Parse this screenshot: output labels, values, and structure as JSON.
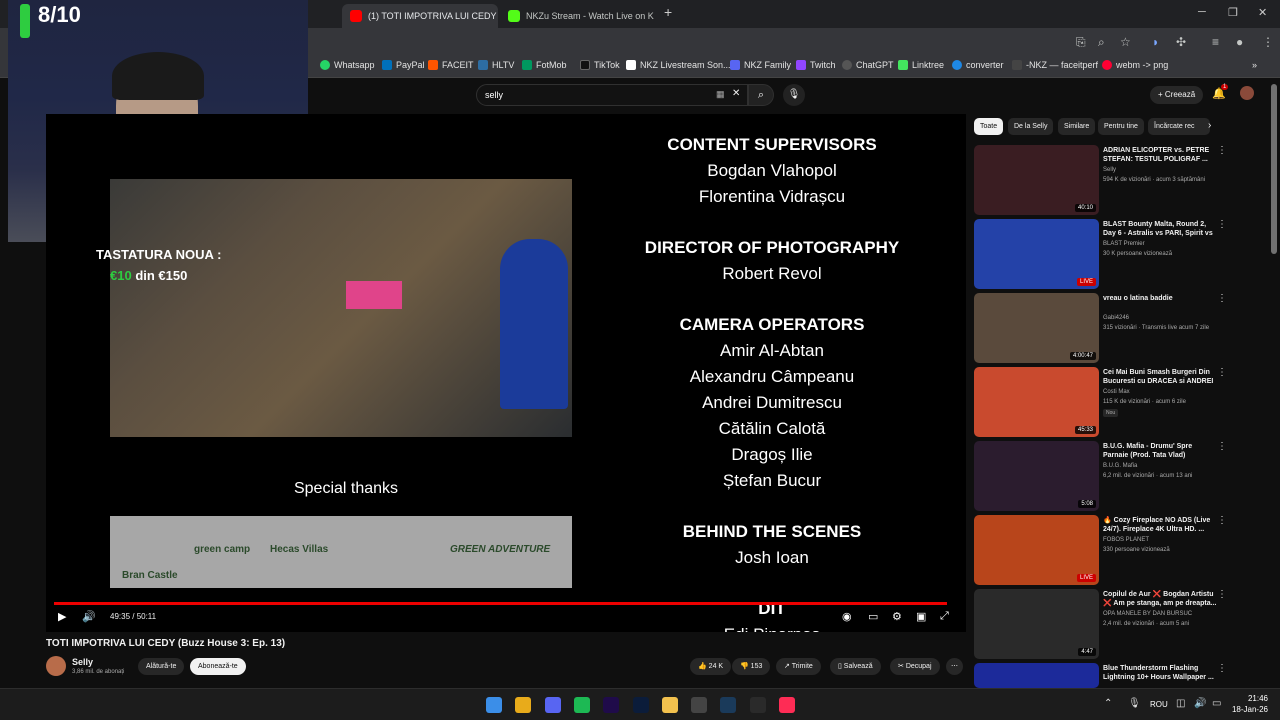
{
  "browser": {
    "tabs": [
      {
        "label": "(1) TOTI IMPOTRIVA LUI CEDY (",
        "active": true,
        "favicon_color": "#ff0000"
      },
      {
        "label": "NKZu Stream - Watch Live on K",
        "active": false,
        "favicon_color": "#53fc18"
      }
    ],
    "bookmarks": [
      {
        "label": "Whatsapp",
        "color": "#25d366"
      },
      {
        "label": "PayPal",
        "color": "#0070ba"
      },
      {
        "label": "FACEIT",
        "color": "#ff5500"
      },
      {
        "label": "HLTV",
        "color": "#2d6da3"
      },
      {
        "label": "FotMob",
        "color": "#00985f"
      },
      {
        "label": "TikTok",
        "color": "#111111"
      },
      {
        "label": "NKZ Livestream Son...",
        "color": "#ffffff"
      },
      {
        "label": "NKZ Family",
        "color": "#5865f2"
      },
      {
        "label": "Twitch",
        "color": "#9146ff"
      },
      {
        "label": "ChatGPT",
        "color": "#555555"
      },
      {
        "label": "Linktree",
        "color": "#43e55e"
      },
      {
        "label": "converter",
        "color": "#1e88e5"
      },
      {
        "label": "-NKZ — faceitperf",
        "color": "#444444"
      },
      {
        "label": "webm -> png",
        "color": "#ff0033"
      }
    ]
  },
  "overlay": {
    "score": "8/10"
  },
  "youtube": {
    "search_query": "selly",
    "create_label": "Creează",
    "notifications_count": "1"
  },
  "video": {
    "overlay_line1": "TASTATURA NOUA :",
    "overlay_price_green": "€10",
    "overlay_price_rest": " din €150",
    "special_thanks": "Special thanks",
    "sponsors": [
      "Bran Castle",
      "green camp",
      "Hecas Villas",
      "GREEN ADVENTURE"
    ],
    "credits": [
      {
        "heading": "CONTENT SUPERVISORS",
        "names": [
          "Bogdan Vlahopol",
          "Florentina Vidrașcu"
        ]
      },
      {
        "heading": "DIRECTOR OF PHOTOGRAPHY",
        "names": [
          "Robert Revol"
        ]
      },
      {
        "heading": "CAMERA OPERATORS",
        "names": [
          "Amir Al-Abtan",
          "Alexandru Câmpeanu",
          "Andrei Dumitrescu",
          "Cătălin Calotă",
          "Dragoș Ilie",
          "Ștefan Bucur"
        ]
      },
      {
        "heading": "BEHIND THE SCENES",
        "names": [
          "Josh Ioan"
        ]
      },
      {
        "heading": "DIT",
        "names": [
          "Edi Pinarpas"
        ]
      }
    ],
    "time": "49:35 / 50:11",
    "progress": 0.988,
    "title": "TOTI IMPOTRIVA LUI CEDY (Buzz House 3: Ep. 13)",
    "channel": "Selly",
    "subscribers": "3,86 mil. de abonați",
    "join_label": "Alătură-te",
    "subscribed_label": "Abonează-te",
    "likes": "24 K",
    "dislikes": "153",
    "share_label": "Trimite",
    "save_label": "Salvează",
    "clip_label": "Decupaj"
  },
  "sidebar": {
    "chips": [
      "Toate",
      "De la Selly",
      "Similare",
      "Pentru tine",
      "Încărcate rec"
    ],
    "items": [
      {
        "title": "ADRIAN ELICOPTER vs. PETRE STEFAN: TESTUL POLIGRAF ...",
        "channel": "Selly",
        "meta": "594 K de vizionări · acum 3 săptămâni",
        "duration": "40:10",
        "live": false,
        "color": "#3a1d22",
        "badge": ""
      },
      {
        "title": "BLAST Bounty Malta, Round 2, Day 6 - Astralis vs PARI, Spirit vs IC, ...",
        "channel": "BLAST Premier",
        "meta": "30 K persoane vizionează",
        "duration": "LIVE",
        "live": true,
        "color": "#2442a8",
        "badge": ""
      },
      {
        "title": "vreau o latina baddie",
        "channel": "Gabi4246",
        "meta": "315 vizionări · Transmis live acum 7 zile",
        "duration": "4:00:47",
        "live": false,
        "color": "#5a4a3c",
        "badge": ""
      },
      {
        "title": "Cei Mai Buni Smash Burgeri Din Bucuresti cu DRACEA si ANDREI ...",
        "channel": "Costi Max",
        "meta": "115 K de vizionări · acum 6 zile",
        "duration": "45:33",
        "live": false,
        "color": "#c94a2e",
        "badge": "Nou"
      },
      {
        "title": "B.U.G. Mafia - Drumu' Spre Parnaie (Prod. Tata Vlad)",
        "channel": "B.U.G. Mafia",
        "meta": "6,2 mil. de vizionări · acum 13 ani",
        "duration": "5:08",
        "live": false,
        "color": "#2b1c2e",
        "badge": ""
      },
      {
        "title": "🔥 Cozy Fireplace NO ADS (Live 24/7). Fireplace 4K Ultra HD. ...",
        "channel": "FOBOS PLANET",
        "meta": "330 persoane vizionează",
        "duration": "LIVE",
        "live": true,
        "color": "#b8451b",
        "badge": ""
      },
      {
        "title": "Copilul de Aur ❌ Bogdan Artistu ❌ Am pe stanga, am pe dreapta...",
        "channel": "OPA MANELE BY DAN BURSUC",
        "meta": "2,4 mil. de vizionări · acum 5 ani",
        "duration": "4:47",
        "live": false,
        "color": "#2a2a2a",
        "badge": ""
      },
      {
        "title": "Blue Thunderstorm Flashing Lightning 10+ Hours Wallpaper ...",
        "channel": "",
        "meta": "",
        "duration": "",
        "live": false,
        "color": "#1c2a9a",
        "badge": ""
      }
    ]
  },
  "taskbar": {
    "apps": [
      {
        "name": "windows-start",
        "color": "#3b8ee8"
      },
      {
        "name": "chrome",
        "color": "#e8ab1b"
      },
      {
        "name": "discord",
        "color": "#5865f2"
      },
      {
        "name": "spotify",
        "color": "#1db954"
      },
      {
        "name": "premiere",
        "color": "#1f0b4a"
      },
      {
        "name": "photoshop",
        "color": "#0b1c3a"
      },
      {
        "name": "file-explorer",
        "color": "#f2c14e"
      },
      {
        "name": "obs",
        "color": "#444444"
      },
      {
        "name": "steam",
        "color": "#1a3a5a"
      },
      {
        "name": "faceit",
        "color": "#2a2a2a"
      },
      {
        "name": "tiktok",
        "color": "#fe2c55"
      }
    ],
    "language": "ROU",
    "time": "21:46",
    "date": "18-Jan-26"
  }
}
